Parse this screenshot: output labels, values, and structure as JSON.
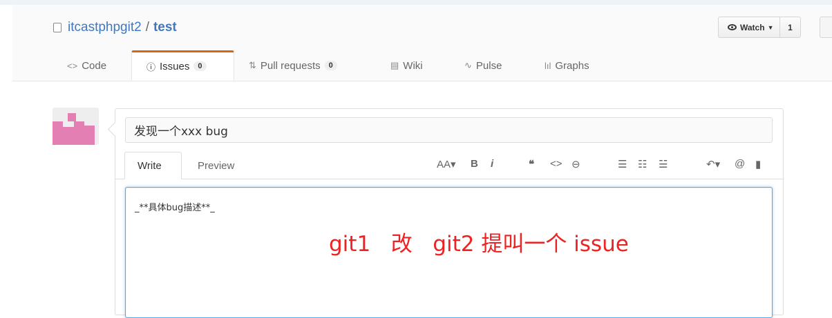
{
  "repo": {
    "owner": "itcastphpgit2",
    "separator": "/",
    "name": "test"
  },
  "watch": {
    "label": "Watch",
    "count": "1"
  },
  "tabs": [
    {
      "label": "Code",
      "icon": "code-icon",
      "glyph": "<>"
    },
    {
      "label": "Issues",
      "icon": "issue-opened-icon",
      "glyph": "ⓘ",
      "counter": "0",
      "selected": true
    },
    {
      "label": "Pull requests",
      "icon": "git-pull-request-icon",
      "glyph": "⇅",
      "counter": "0"
    },
    {
      "label": "Wiki",
      "icon": "book-icon",
      "glyph": "▤"
    },
    {
      "label": "Pulse",
      "icon": "pulse-icon",
      "glyph": "∿"
    },
    {
      "label": "Graphs",
      "icon": "graph-icon",
      "glyph": "lıl"
    }
  ],
  "issue_form": {
    "title_value": "发现一个xxx   bug",
    "write_tab": "Write",
    "preview_tab": "Preview",
    "body_text": "_**具体bug描述**_"
  },
  "toolbar": {
    "header": "AA▾",
    "bold": "B",
    "italic": "i",
    "quote": "❝",
    "code": "<>",
    "link": "⊖",
    "unordered_list": "☰",
    "ordered_list": "☷",
    "task_list": "☱",
    "reply": "↶▾",
    "mention": "@",
    "reference": "▮"
  },
  "annotation": "git1   改   git2 提叫一个 issue",
  "colors": {
    "link": "#4078c0",
    "selected_tab_accent": "#d26911",
    "annotation": "#ee2222",
    "focus_border": "#51a7e8",
    "avatar_pink": "#e37fb2"
  }
}
